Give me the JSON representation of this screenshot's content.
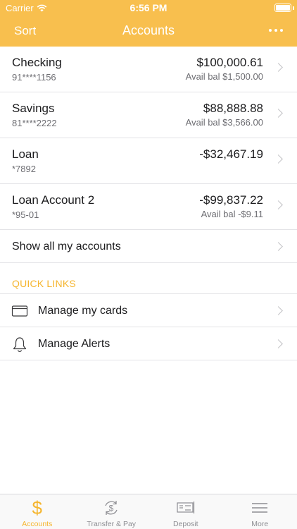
{
  "status_bar": {
    "carrier": "Carrier",
    "time": "6:56 PM"
  },
  "nav": {
    "sort_label": "Sort",
    "title": "Accounts"
  },
  "accounts": [
    {
      "name": "Checking",
      "number": "91****1156",
      "amount": "$100,000.61",
      "avail": "Avail bal $1,500.00"
    },
    {
      "name": "Savings",
      "number": "81****2222",
      "amount": "$88,888.88",
      "avail": "Avail bal $3,566.00"
    },
    {
      "name": "Loan",
      "number": "*7892",
      "amount": "-$32,467.19",
      "avail": ""
    },
    {
      "name": "Loan Account 2",
      "number": "*95-01",
      "amount": "-$99,837.22",
      "avail": "Avail bal -$9.11"
    }
  ],
  "show_all_label": "Show all my accounts",
  "quick_links": {
    "header": "QUICK LINKS",
    "items": [
      {
        "label": "Manage my cards",
        "icon": "card-icon"
      },
      {
        "label": "Manage Alerts",
        "icon": "bell-icon"
      }
    ]
  },
  "tabs": [
    {
      "label": "Accounts",
      "icon": "dollar-icon",
      "active": true
    },
    {
      "label": "Transfer & Pay",
      "icon": "transfer-icon",
      "active": false
    },
    {
      "label": "Deposit",
      "icon": "check-deposit-icon",
      "active": false
    },
    {
      "label": "More",
      "icon": "menu-icon",
      "active": false
    }
  ],
  "colors": {
    "accent": "#f8bf4e",
    "accent_text": "#f5b52e",
    "divider": "#e3e3e6"
  }
}
